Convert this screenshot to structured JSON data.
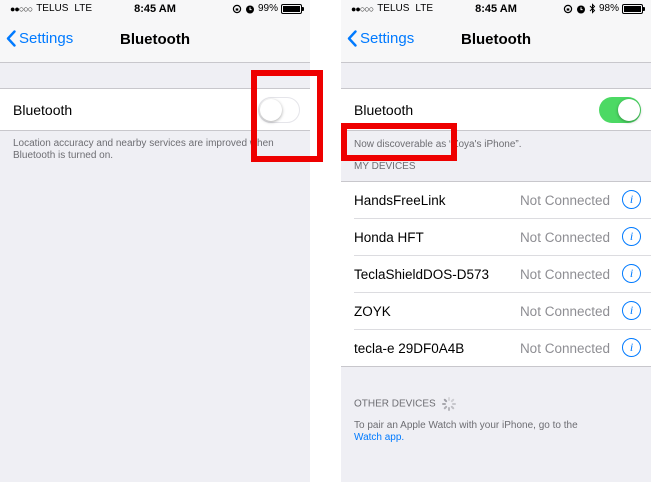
{
  "left_screen": {
    "status": {
      "carrier": "TELUS",
      "network": "LTE",
      "time": "8:45 AM",
      "battery": "99%",
      "battery_level": 0.99
    },
    "nav": {
      "back_label": "Settings",
      "title": "Bluetooth"
    },
    "bluetooth": {
      "label": "Bluetooth",
      "toggle_on": false
    },
    "footnote": "Location accuracy and nearby services are improved when Bluetooth is turned on."
  },
  "right_screen": {
    "status": {
      "carrier": "TELUS",
      "network": "LTE",
      "time": "8:45 AM",
      "battery": "98%",
      "battery_level": 0.98
    },
    "nav": {
      "back_label": "Settings",
      "title": "Bluetooth"
    },
    "bluetooth": {
      "label": "Bluetooth",
      "toggle_on": true
    },
    "discoverable": "Now discoverable as “Zoya's iPhone”.",
    "my_devices_header": "MY DEVICES",
    "devices": [
      {
        "name": "HandsFreeLink",
        "status": "Not Connected"
      },
      {
        "name": "Honda HFT",
        "status": "Not Connected"
      },
      {
        "name": "TeclaShieldDOS-D573",
        "status": "Not Connected"
      },
      {
        "name": "ZOYK",
        "status": "Not Connected"
      },
      {
        "name": "tecla-e 29DF0A4B",
        "status": "Not Connected"
      }
    ],
    "other_devices_header": "OTHER DEVICES",
    "watch_note": "To pair an Apple Watch with your iPhone, go to the",
    "watch_link": "Watch app."
  },
  "colors": {
    "accent": "#007aff",
    "toggle_on": "#4cd964",
    "highlight": "#ee0000"
  }
}
